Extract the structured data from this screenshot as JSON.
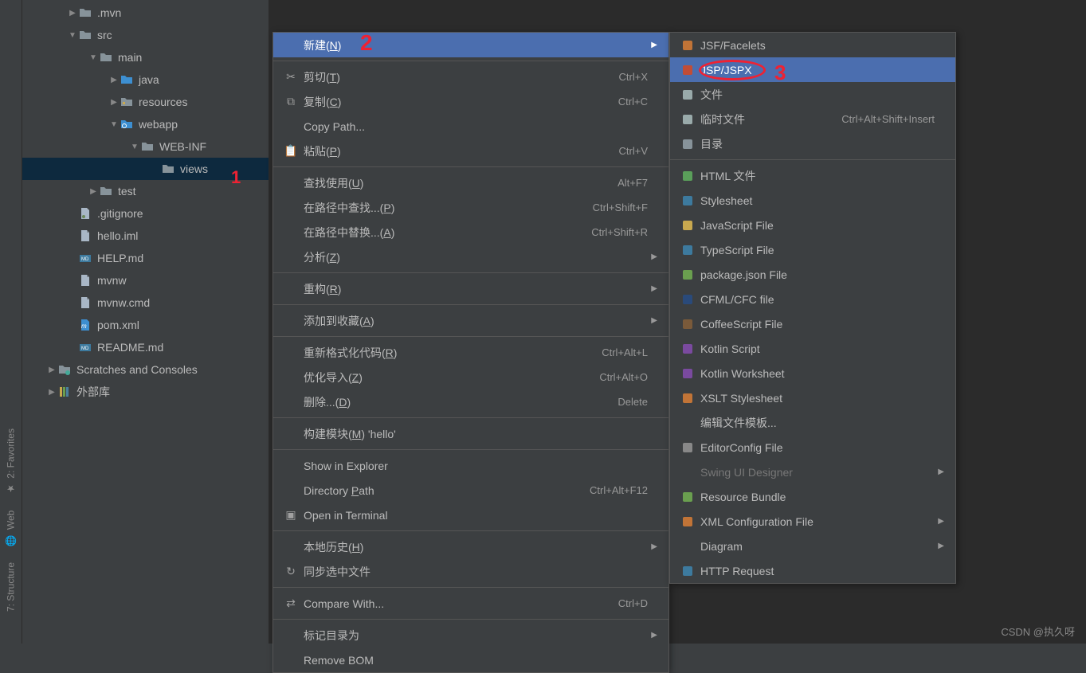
{
  "sidebar_tabs": {
    "favorites": "2: Favorites",
    "web": "Web",
    "structure": "7: Structure"
  },
  "tree": [
    {
      "indent": 1,
      "chev": "▶",
      "icon": "folder",
      "label": ".mvn"
    },
    {
      "indent": 1,
      "chev": "▼",
      "icon": "folder",
      "label": "src"
    },
    {
      "indent": 2,
      "chev": "▼",
      "icon": "folder",
      "label": "main"
    },
    {
      "indent": 3,
      "chev": "▶",
      "icon": "folder-b",
      "label": "java"
    },
    {
      "indent": 3,
      "chev": "▶",
      "icon": "folder-res",
      "label": "resources"
    },
    {
      "indent": 3,
      "chev": "▼",
      "icon": "folder-web",
      "label": "webapp"
    },
    {
      "indent": 4,
      "chev": "▼",
      "icon": "folder",
      "label": "WEB-INF"
    },
    {
      "indent": 5,
      "chev": "",
      "icon": "folder",
      "label": "views",
      "selected": true
    },
    {
      "indent": 2,
      "chev": "▶",
      "icon": "folder",
      "label": "test"
    },
    {
      "indent": 1,
      "chev": "",
      "icon": "file-ign",
      "label": ".gitignore"
    },
    {
      "indent": 1,
      "chev": "",
      "icon": "file",
      "label": "hello.iml"
    },
    {
      "indent": 1,
      "chev": "",
      "icon": "file-md",
      "label": "HELP.md"
    },
    {
      "indent": 1,
      "chev": "",
      "icon": "file",
      "label": "mvnw"
    },
    {
      "indent": 1,
      "chev": "",
      "icon": "file",
      "label": "mvnw.cmd"
    },
    {
      "indent": 1,
      "chev": "",
      "icon": "file-pom",
      "label": "pom.xml"
    },
    {
      "indent": 1,
      "chev": "",
      "icon": "file-md",
      "label": "README.md"
    },
    {
      "indent": 0,
      "chev": "▶",
      "icon": "scratch",
      "label": "Scratches and Consoles"
    },
    {
      "indent": 0,
      "chev": "▶",
      "icon": "libs",
      "label": "外部库"
    }
  ],
  "menu1": [
    {
      "type": "item",
      "icon": "",
      "label_html": "新建(<u>N</u>)",
      "shortcut": "",
      "arrow": true,
      "hl": true
    },
    {
      "type": "sep"
    },
    {
      "type": "item",
      "icon": "cut",
      "label_html": "剪切(<u>T</u>)",
      "shortcut": "Ctrl+X"
    },
    {
      "type": "item",
      "icon": "copy",
      "label_html": "复制(<u>C</u>)",
      "shortcut": "Ctrl+C"
    },
    {
      "type": "item",
      "icon": "",
      "label_html": "Copy Path...",
      "shortcut": ""
    },
    {
      "type": "item",
      "icon": "paste",
      "label_html": "粘贴(<u>P</u>)",
      "shortcut": "Ctrl+V"
    },
    {
      "type": "sep"
    },
    {
      "type": "item",
      "icon": "",
      "label_html": "查找使用(<u>U</u>)",
      "shortcut": "Alt+F7"
    },
    {
      "type": "item",
      "icon": "",
      "label_html": "在路径中查找...(<u>P</u>)",
      "shortcut": "Ctrl+Shift+F"
    },
    {
      "type": "item",
      "icon": "",
      "label_html": "在路径中替换...(<u>A</u>)",
      "shortcut": "Ctrl+Shift+R"
    },
    {
      "type": "item",
      "icon": "",
      "label_html": "分析(<u>Z</u>)",
      "shortcut": "",
      "arrow": true
    },
    {
      "type": "sep"
    },
    {
      "type": "item",
      "icon": "",
      "label_html": "重构(<u>R</u>)",
      "shortcut": "",
      "arrow": true
    },
    {
      "type": "sep"
    },
    {
      "type": "item",
      "icon": "",
      "label_html": "添加到收藏(<u>A</u>)",
      "shortcut": "",
      "arrow": true
    },
    {
      "type": "sep"
    },
    {
      "type": "item",
      "icon": "",
      "label_html": "重新格式化代码(<u>R</u>)",
      "shortcut": "Ctrl+Alt+L"
    },
    {
      "type": "item",
      "icon": "",
      "label_html": "优化导入(<u>Z</u>)",
      "shortcut": "Ctrl+Alt+O"
    },
    {
      "type": "item",
      "icon": "",
      "label_html": "删除...(<u>D</u>)",
      "shortcut": "Delete"
    },
    {
      "type": "sep"
    },
    {
      "type": "item",
      "icon": "",
      "label_html": "构建模块(<u>M</u>) 'hello'",
      "shortcut": ""
    },
    {
      "type": "sep"
    },
    {
      "type": "item",
      "icon": "",
      "label_html": "Show in Explorer",
      "shortcut": ""
    },
    {
      "type": "item",
      "icon": "",
      "label_html": "Directory <u>P</u>ath",
      "shortcut": "Ctrl+Alt+F12"
    },
    {
      "type": "item",
      "icon": "term",
      "label_html": "Open in Terminal",
      "shortcut": ""
    },
    {
      "type": "sep"
    },
    {
      "type": "item",
      "icon": "",
      "label_html": "本地历史(<u>H</u>)",
      "shortcut": "",
      "arrow": true
    },
    {
      "type": "item",
      "icon": "sync",
      "label_html": "同步选中文件",
      "shortcut": ""
    },
    {
      "type": "sep"
    },
    {
      "type": "item",
      "icon": "diff",
      "label_html": "Compare With...",
      "shortcut": "Ctrl+D"
    },
    {
      "type": "sep"
    },
    {
      "type": "item",
      "icon": "",
      "label_html": "标记目录为",
      "shortcut": "",
      "arrow": true
    },
    {
      "type": "item",
      "icon": "",
      "label_html": "Remove BOM",
      "shortcut": ""
    }
  ],
  "menu2": [
    {
      "type": "item",
      "icon": "f-h",
      "label": "JSF/Facelets"
    },
    {
      "type": "item",
      "icon": "f-jsp",
      "label": "JSP/JSPX",
      "hl": true
    },
    {
      "type": "item",
      "icon": "f-file",
      "label": "文件"
    },
    {
      "type": "item",
      "icon": "f-temp",
      "label": "临时文件",
      "shortcut": "Ctrl+Alt+Shift+Insert"
    },
    {
      "type": "item",
      "icon": "f-dir",
      "label": "目录"
    },
    {
      "type": "sep"
    },
    {
      "type": "item",
      "icon": "f-html",
      "label": "HTML 文件"
    },
    {
      "type": "item",
      "icon": "f-css",
      "label": "Stylesheet"
    },
    {
      "type": "item",
      "icon": "f-js",
      "label": "JavaScript File"
    },
    {
      "type": "item",
      "icon": "f-ts",
      "label": "TypeScript File"
    },
    {
      "type": "item",
      "icon": "f-pkg",
      "label": "package.json File"
    },
    {
      "type": "item",
      "icon": "f-cf",
      "label": "CFML/CFC file"
    },
    {
      "type": "item",
      "icon": "f-coffee",
      "label": "CoffeeScript File"
    },
    {
      "type": "item",
      "icon": "f-kt",
      "label": "Kotlin Script"
    },
    {
      "type": "item",
      "icon": "f-kt",
      "label": "Kotlin Worksheet"
    },
    {
      "type": "item",
      "icon": "f-xsl",
      "label": "XSLT Stylesheet"
    },
    {
      "type": "item",
      "icon": "",
      "label": "编辑文件模板..."
    },
    {
      "type": "item",
      "icon": "f-gear",
      "label": "EditorConfig File"
    },
    {
      "type": "item",
      "icon": "",
      "label": "Swing UI Designer",
      "arrow": true,
      "dim": true
    },
    {
      "type": "item",
      "icon": "f-res",
      "label": "Resource Bundle"
    },
    {
      "type": "item",
      "icon": "f-xml",
      "label": "XML Configuration File",
      "arrow": true
    },
    {
      "type": "item",
      "icon": "",
      "label": "Diagram",
      "arrow": true
    },
    {
      "type": "item",
      "icon": "f-api",
      "label": "HTTP Request"
    }
  ],
  "annotations": {
    "a1": "1",
    "a2": "2",
    "a3": "3"
  },
  "watermark": "CSDN @执久呀"
}
